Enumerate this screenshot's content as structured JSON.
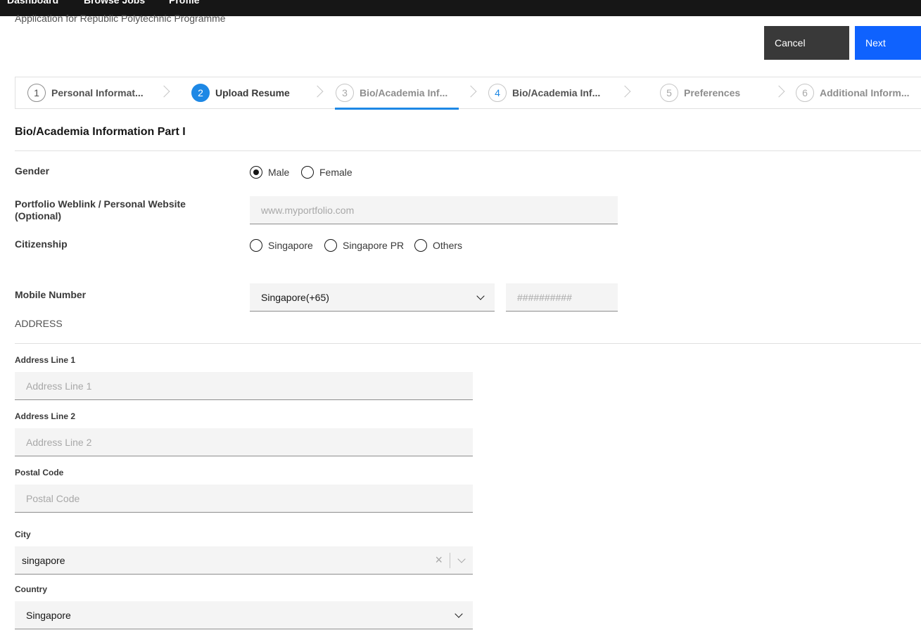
{
  "topnav": {
    "items": [
      "Dashboard",
      "Browse Jobs",
      "Profile"
    ]
  },
  "subtitle": "Application for Republic Polytechnic Programme",
  "actions": {
    "cancel": "Cancel",
    "next": "Next"
  },
  "steps": [
    {
      "num": "1",
      "label": "Personal Informat..."
    },
    {
      "num": "2",
      "label": "Upload Resume"
    },
    {
      "num": "3",
      "label": "Bio/Academia Inf..."
    },
    {
      "num": "4",
      "label": "Bio/Academia Inf..."
    },
    {
      "num": "5",
      "label": "Preferences"
    },
    {
      "num": "6",
      "label": "Additional Inform..."
    }
  ],
  "section_title": "Bio/Academia Information Part I",
  "gender": {
    "label": "Gender",
    "options": [
      "Male",
      "Female"
    ],
    "selected": "Male"
  },
  "portfolio": {
    "label_line1": "Portfolio Weblink / Personal Website",
    "label_line2": "(Optional)",
    "placeholder": "www.myportfolio.com"
  },
  "citizenship": {
    "label": "Citizenship",
    "options": [
      "Singapore",
      "Singapore PR",
      "Others"
    ]
  },
  "mobile": {
    "label": "Mobile Number",
    "country_code": "Singapore(+65)",
    "placeholder": "##########"
  },
  "address": {
    "heading": "ADDRESS",
    "line1_label": "Address Line 1",
    "line1_placeholder": "Address Line 1",
    "line2_label": "Address Line 2",
    "line2_placeholder": "Address Line 2",
    "postal_label": "Postal Code",
    "postal_placeholder": "Postal Code",
    "city_label": "City",
    "city_value": "singapore",
    "country_label": "Country",
    "country_value": "Singapore"
  }
}
